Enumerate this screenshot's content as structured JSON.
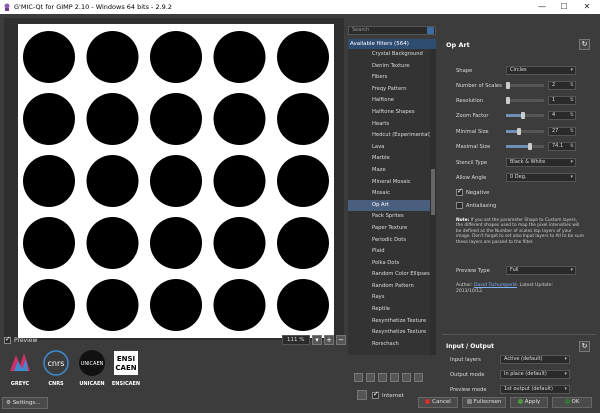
{
  "window": {
    "title": "G'MIC-Qt for GIMP 2.10 - Windows 64 bits - 2.9.2",
    "minimize": "—",
    "maximize": "☐",
    "close": "✕"
  },
  "preview": {
    "checkbox_label": "Preview",
    "checked": true,
    "zoom_value": "111 %"
  },
  "logos": [
    "GREYC",
    "CNRS",
    "UNICAEN",
    "ENSICAEN"
  ],
  "logo_text": {
    "cnrs": "cnrs",
    "unicaen": "UNICAEN",
    "ensi_top": "ENSI",
    "ensi_bottom": "CAEN"
  },
  "settings_button": "Settings...",
  "filters": {
    "search_placeholder": "Search",
    "available_label": "Available filters (564)",
    "items": [
      "Crystal Background",
      "Denim Texture",
      "Fibers",
      "Freqy Pattern",
      "Halftone",
      "Halftone Shapes",
      "Hearts",
      "Hedcut (Experimental)",
      "Lava",
      "Marble",
      "Maze",
      "Mineral Mosaic",
      "Mosaic",
      "Op Art",
      "Pack Sprites",
      "Paper Texture",
      "Periodic Dots",
      "Plaid",
      "Polka Dots",
      "Random Color Ellipses",
      "Random Pattern",
      "Rays",
      "Reptile",
      "Resynthetize Texture",
      "Resynthetize Texture",
      "Rorschach"
    ],
    "selected_index": 13,
    "internet_label": "Internet",
    "internet_checked": true
  },
  "params": {
    "title": "Op Art",
    "shape_label": "Shape",
    "shape_value": "Circles",
    "sliders": [
      {
        "label": "Number of Scales",
        "value": "2",
        "fraction": 0.0
      },
      {
        "label": "Resolution",
        "value": "1",
        "fraction": 0.0
      },
      {
        "label": "Zoom Factor",
        "value": "4",
        "fraction": 0.45
      },
      {
        "label": "Minimal Size",
        "value": "27",
        "fraction": 0.35
      },
      {
        "label": "Maximal Size",
        "value": "74.1",
        "fraction": 0.62
      }
    ],
    "stencil_label": "Stencil Type",
    "stencil_value": "Black & White",
    "angle_label": "Allow Angle",
    "angle_value": "0 Deg.",
    "negative_label": "Negative",
    "negative_checked": true,
    "antialiasing_label": "Antialiasing",
    "antialiasing_checked": false,
    "note_prefix": "Note:",
    "note_body": " If you set the parameter Shape to Custom layers, the different shapes used to map the pixel intensities will be defined as the Number of scales top layers of your image. Don't forget to set also Input layers to All to be sure these layers are passed to the filter.",
    "preview_type_label": "Preview Type",
    "preview_type_value": "Full",
    "author_prefix": "Author: ",
    "author_name": "David Tschumperlé",
    "author_suffix": ".    Latest Update:",
    "author_date": "2013/10/12."
  },
  "io": {
    "title": "Input / Output",
    "input_layers_label": "Input layers",
    "input_layers_value": "Active (default)",
    "output_mode_label": "Output mode",
    "output_mode_value": "In place (default)",
    "preview_mode_label": "Preview mode",
    "preview_mode_value": "1st output (default)"
  },
  "buttons": {
    "cancel": "Cancel",
    "fullscreen": "Fullscreen",
    "apply": "Apply",
    "ok": "OK"
  },
  "colors": {
    "selection": "#4a5f7d",
    "cancel_icon": "#d9302c",
    "apply_icon": "#4a9d3a",
    "ok_icon": "#2e7d32"
  }
}
